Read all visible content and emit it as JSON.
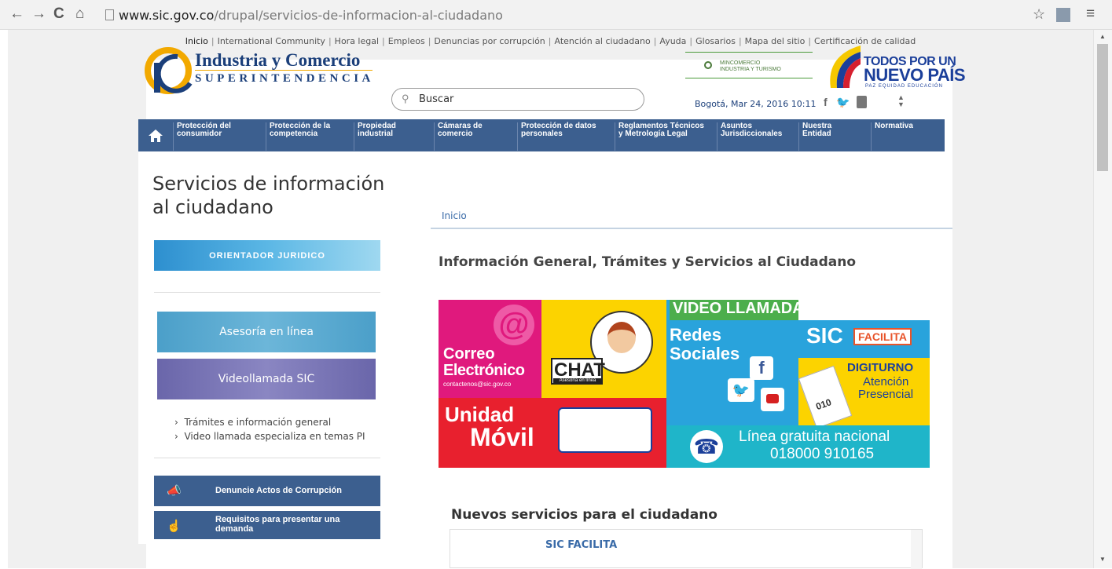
{
  "browser": {
    "url_domain": "www.sic.gov.co",
    "url_path": "/drupal/servicios-de-informacion-al-ciudadano"
  },
  "toplinks": [
    "Inicio",
    "International Community",
    "Hora legal",
    "Empleos",
    "Denuncias por corrupción",
    "Atención al ciudadano",
    "Ayuda",
    "Glosarios",
    "Mapa del sitio",
    "Certificación de calidad"
  ],
  "header": {
    "logo_line1": "Industria y Comercio",
    "logo_line2": "SUPERINTENDENCIA",
    "search_placeholder": "Buscar",
    "gov_text1": "MINCOMERCIO",
    "gov_text2": "INDUSTRIA Y TURISMO",
    "todos_l1": "TODOS POR UN",
    "todos_l2": "NUEVO PAÍS",
    "todos_l3": "PAZ  EQUIDAD  EDUCACIÓN",
    "date": "Bogotá, Mar 24, 2016 10:11"
  },
  "nav": [
    {
      "l1": "Protección del",
      "l2": "consumidor"
    },
    {
      "l1": "Protección de la",
      "l2": "competencia"
    },
    {
      "l1": "Propiedad",
      "l2": "industrial"
    },
    {
      "l1": "Cámaras de",
      "l2": "comercio"
    },
    {
      "l1": "Protección de datos",
      "l2": "personales"
    },
    {
      "l1": "Reglamentos Técnicos",
      "l2": "y Metrología Legal"
    },
    {
      "l1": "Asuntos",
      "l2": "Jurisdiccionales"
    },
    {
      "l1": "Nuestra",
      "l2": "Entidad"
    },
    {
      "l1": "Normativa",
      "l2": ""
    }
  ],
  "sidebar": {
    "title": "Servicios de información al ciudadano",
    "orientador": "ORIENTADOR JURIDICO",
    "asesoria": "Asesoría en línea",
    "videollamada": "Videollamada SIC",
    "links": [
      "Trámites e información general",
      "Video llamada especializa en temas PI"
    ],
    "denuncie": "Denuncie Actos de Corrupción",
    "requisitos": "Requisitos para presentar una demanda"
  },
  "main": {
    "breadcrumb": "Inicio",
    "heading": "Información General, Trámites y Servicios al Ciudadano",
    "banner": {
      "correo1": "Correo",
      "correo2": "Electrónico",
      "correo_email": "contactenos@sic.gov.co",
      "chat": "CHAT",
      "chat_sub": "Asesoría en línea",
      "video": "VIDEO LLAMADA",
      "redes1": "Redes",
      "redes2": "Sociales",
      "sic": "SIC",
      "facilita": "FACILITA",
      "digiturno": "DIGITURNO",
      "atencion": "Atención",
      "presencial": "Presencial",
      "ticket": "010",
      "unidad": "Unidad",
      "movil": "Móvil",
      "linea": "Línea gratuita nacional",
      "telefono": "018000 910165"
    },
    "nuevos": "Nuevos servicios para el ciudadano",
    "card_title": "SIC FACILITA"
  }
}
